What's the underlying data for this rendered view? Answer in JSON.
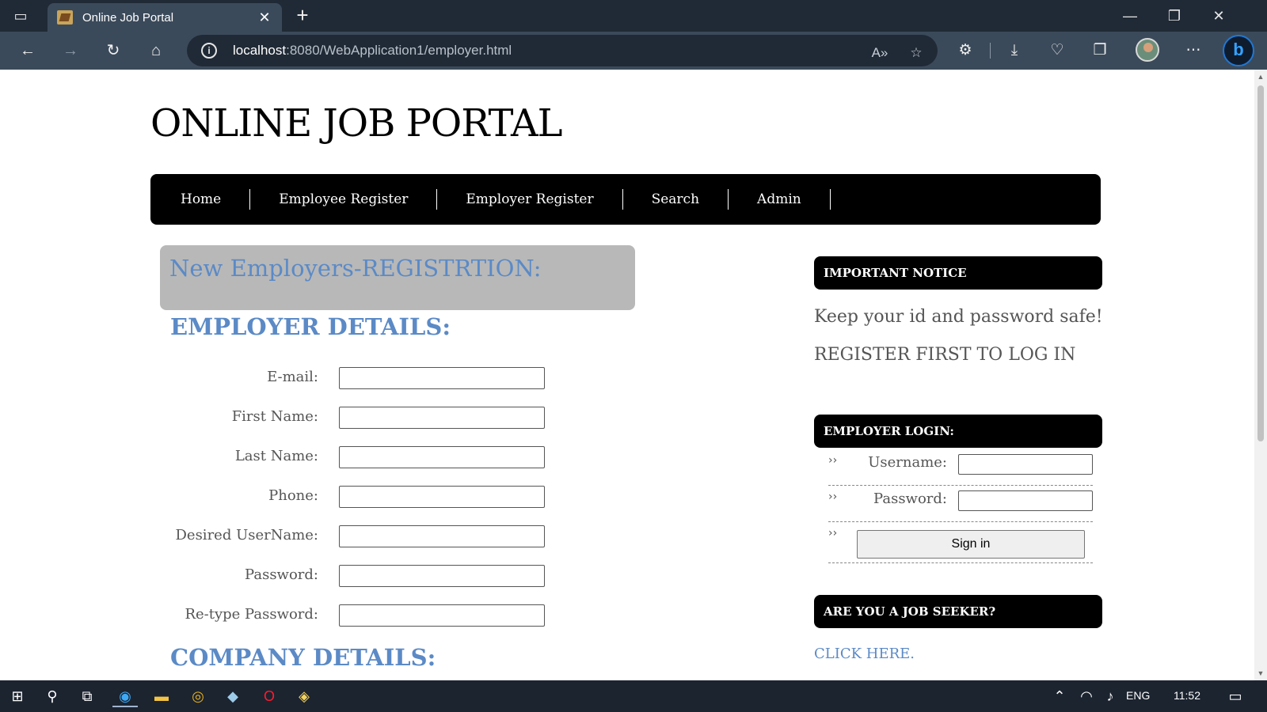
{
  "browser": {
    "tab_title": "Online Job Portal",
    "tab_close": "✕",
    "new_tab": "+",
    "url_host": "localhost",
    "url_path": ":8080/WebApplication1/employer.html",
    "window_controls": [
      "—",
      "❐",
      "✕"
    ]
  },
  "site": {
    "title": "ONLINE JOB PORTAL",
    "nav": [
      "Home",
      "Employee Register",
      "Employer Register",
      "Search",
      "Admin"
    ]
  },
  "registration": {
    "banner": "New Employers-REGISTRTION:",
    "employer_heading": "EMPLOYER DETAILS:",
    "fields": [
      {
        "label": "E-mail:",
        "value": ""
      },
      {
        "label": "First Name:",
        "value": ""
      },
      {
        "label": "Last Name:",
        "value": ""
      },
      {
        "label": "Phone:",
        "value": ""
      },
      {
        "label": "Desired UserName:",
        "value": ""
      },
      {
        "label": "Password:",
        "value": ""
      },
      {
        "label": "Re-type Password:",
        "value": ""
      }
    ],
    "company_heading": "COMPANY DETAILS:"
  },
  "sidebar": {
    "notice_heading": "IMPORTANT NOTICE",
    "notice_line1": "Keep your id and password safe!",
    "notice_line2": "REGISTER FIRST TO LOG IN",
    "login_heading": "EMPLOYER LOGIN:",
    "bullet": "››",
    "username_label": "Username:",
    "password_label": "Password:",
    "signin_label": "Sign in",
    "seeker_heading": "ARE YOU A JOB SEEKER?",
    "click_here": "CLICK HERE."
  },
  "taskbar": {
    "language": "ENG",
    "time": "11:52"
  },
  "colors": {
    "accent_blue": "#5b8ac6",
    "nav_black": "#000000",
    "banner_gray": "#b8b8b8"
  }
}
